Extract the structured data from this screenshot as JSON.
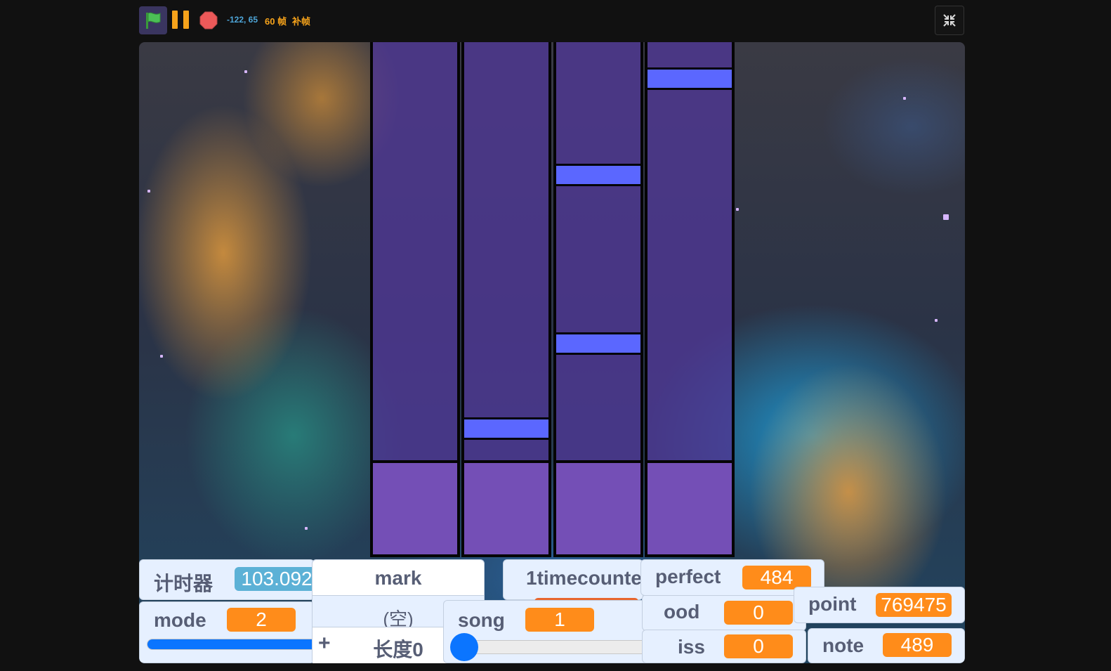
{
  "toolbar": {
    "green_flag_icon": "green-flag-icon",
    "pause_icon": "pause-icon",
    "stop_icon": "stop-sign-icon",
    "fullscreen_exit_icon": "fullscreen-exit-icon",
    "coordinates": "-122, 65",
    "fps": "60 帧",
    "interpolation": "补帧"
  },
  "colors": {
    "orange": "#ff8c1a",
    "blue_value": "#5cb1d6",
    "note": "#5b67ff",
    "lane": "#503796",
    "hit_zone": "#744fb6",
    "monitor_bg": "#e6f0ff"
  },
  "monitors": {
    "timer": {
      "label": "计时器",
      "value": "103.092"
    },
    "mark_list": {
      "title": "mark",
      "empty": "(空)",
      "add": "+",
      "length": "长度0"
    },
    "timecounter": {
      "label": "1timecounte"
    },
    "perfect": {
      "label": "perfect",
      "value": "484"
    },
    "good": {
      "label": "ood",
      "value": "0"
    },
    "miss": {
      "label": "iss",
      "value": "0"
    },
    "point": {
      "label": "point",
      "value": "769475"
    },
    "note": {
      "label": "note",
      "value": "489"
    },
    "mode": {
      "label": "mode",
      "value": "2"
    },
    "song": {
      "label": "song",
      "value": "1"
    }
  }
}
